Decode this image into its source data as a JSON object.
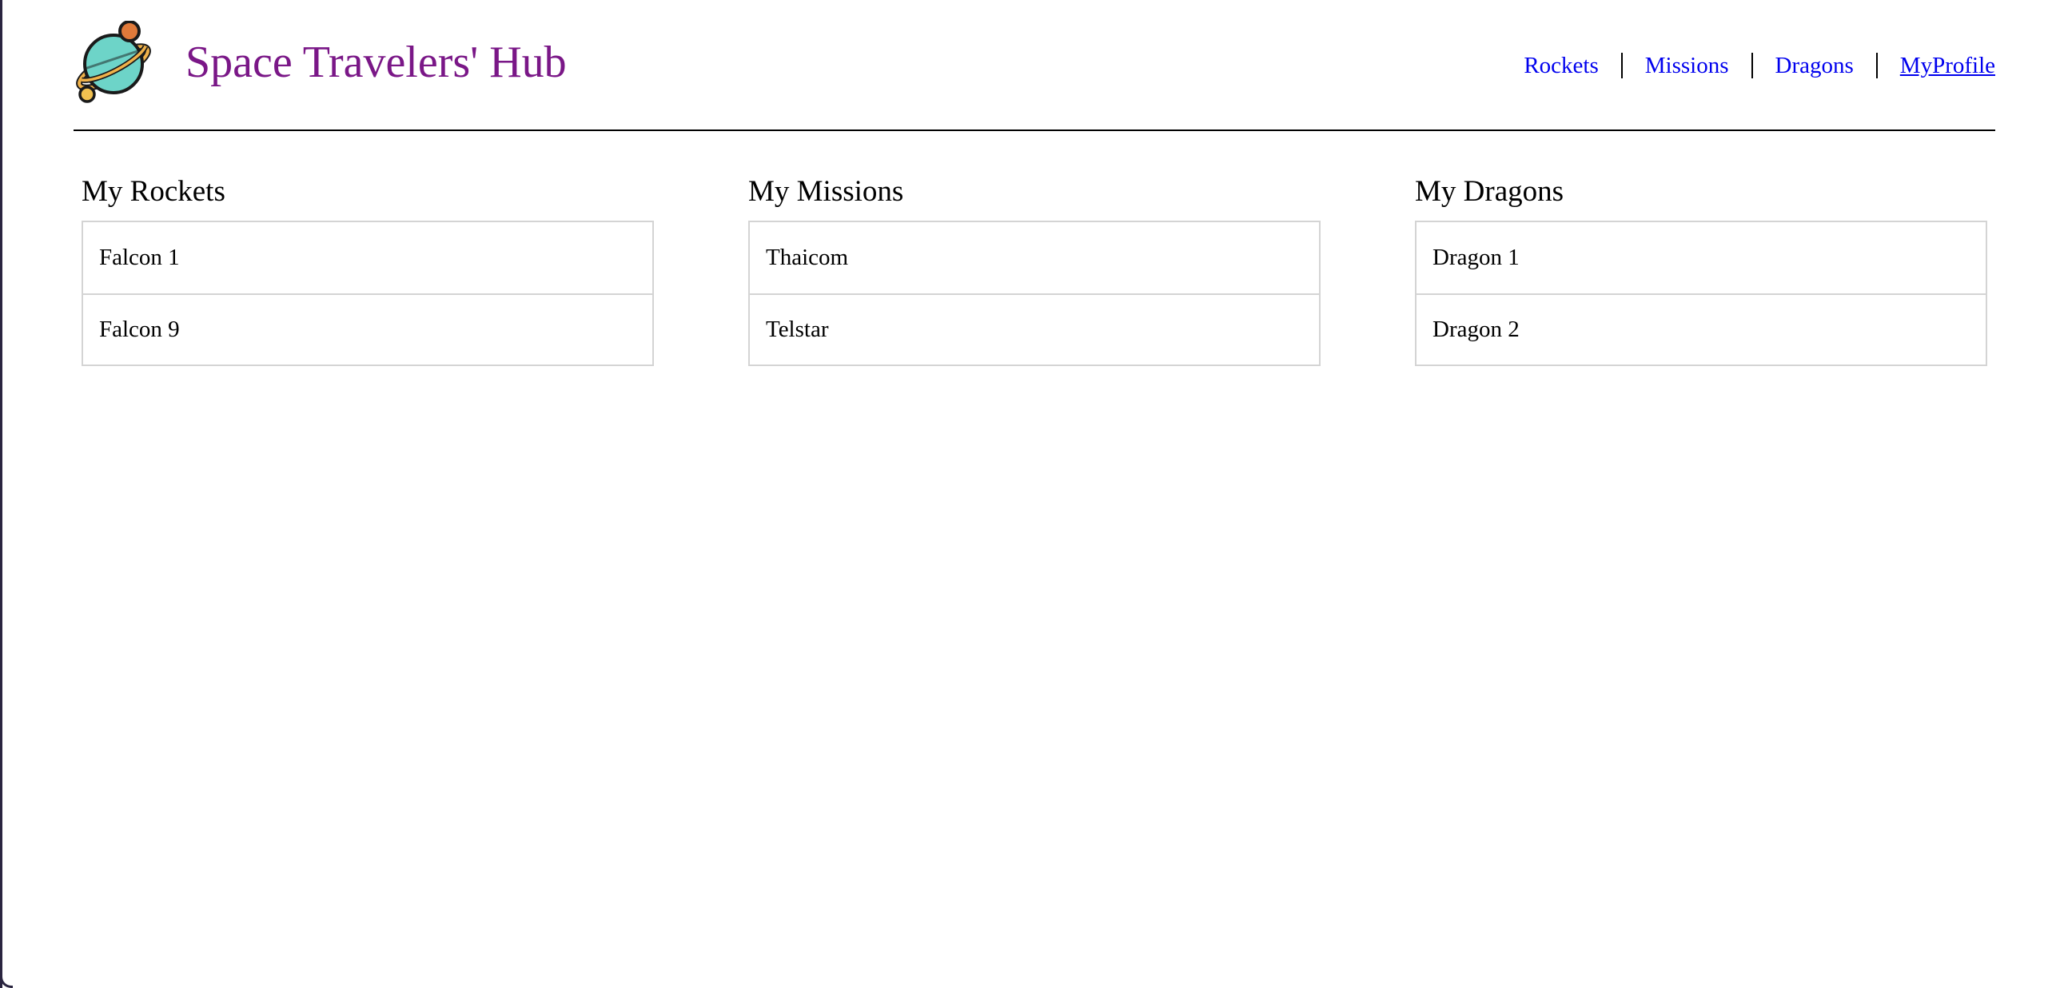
{
  "header": {
    "title": "Space Travelers' Hub",
    "logo_icon": "planet-icon",
    "title_color": "#7a1787"
  },
  "nav": {
    "items": [
      {
        "label": "Rockets",
        "active": false
      },
      {
        "label": "Missions",
        "active": false
      },
      {
        "label": "Dragons",
        "active": false
      },
      {
        "label": "MyProfile",
        "active": true
      }
    ],
    "link_color": "#0000ee"
  },
  "profile": {
    "rockets": {
      "heading": "My Rockets",
      "items": [
        "Falcon 1",
        "Falcon 9"
      ]
    },
    "missions": {
      "heading": "My Missions",
      "items": [
        "Thaicom",
        "Telstar"
      ]
    },
    "dragons": {
      "heading": "My Dragons",
      "items": [
        "Dragon 1",
        "Dragon 2"
      ]
    }
  }
}
